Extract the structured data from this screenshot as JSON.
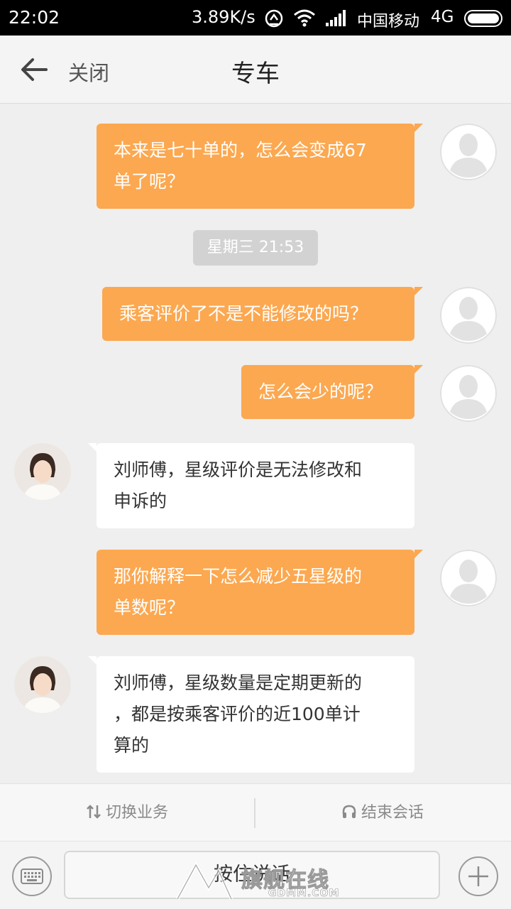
{
  "status_bar": {
    "time": "22:02",
    "speed": "3.89K/s",
    "carrier": "中国移动",
    "network": "4G",
    "icons": [
      "sync-icon",
      "wifi-icon",
      "signal-icon",
      "battery-icon"
    ]
  },
  "header": {
    "back_icon": "arrow-left-icon",
    "close_label": "关闭",
    "title": "专车"
  },
  "messages": [
    {
      "from": "user",
      "lines": [
        "本来是七十单的，怎么会变成67",
        "单了呢？"
      ]
    },
    {
      "timestamp": "星期三 21:53"
    },
    {
      "from": "user",
      "lines": [
        "乘客评价了不是不能修改的吗？"
      ]
    },
    {
      "from": "user",
      "lines": [
        "怎么会少的呢？"
      ]
    },
    {
      "from": "agent",
      "lines": [
        "刘师傅，星级评价是无法修改和",
        "申诉的"
      ]
    },
    {
      "from": "user",
      "lines": [
        "那你解释一下怎么减少五星级的",
        "单数呢？"
      ]
    },
    {
      "from": "agent",
      "lines": [
        "刘师傅，星级数量是定期更新的",
        "，都是按乘客评价的近100单计",
        "算的"
      ]
    }
  ],
  "actions": {
    "switch_label": "切换业务",
    "end_label": "结束会话"
  },
  "input": {
    "hold_to_talk": "按住说话",
    "watermark": "旗舰在线",
    "watermark_sub": "GDMM.COM"
  },
  "colors": {
    "outgoing_bubble": "#fca850",
    "incoming_bubble": "#ffffff",
    "background": "#efefef"
  }
}
